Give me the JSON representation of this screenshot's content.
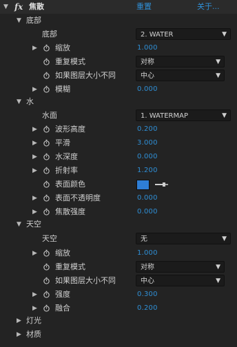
{
  "effect": {
    "fx_glyph": "fx",
    "name": "焦散",
    "reset": "重置",
    "about": "关于..."
  },
  "bottom": {
    "title": "底部",
    "layer_label": "底部",
    "layer_value": "2. WATER",
    "scale_label": "缩放",
    "scale_value": "1.000",
    "repeat_label": "重复模式",
    "repeat_value": "对称",
    "size_label": "如果图层大小不同",
    "size_value": "中心",
    "blur_label": "模糊",
    "blur_value": "0.000"
  },
  "water": {
    "title": "水",
    "surface_label": "水面",
    "surface_value": "1. WATERMAP",
    "wave_label": "波形高度",
    "wave_value": "0.200",
    "smooth_label": "平滑",
    "smooth_value": "3.000",
    "depth_label": "水深度",
    "depth_value": "0.000",
    "refraction_label": "折射率",
    "refraction_value": "1.200",
    "color_label": "表面颜色",
    "color_hex": "#2e7ed6",
    "opacity_label": "表面不透明度",
    "opacity_value": "0.000",
    "caustic_label": "焦散强度",
    "caustic_value": "0.000"
  },
  "sky": {
    "title": "天空",
    "sky_label": "天空",
    "sky_value": "无",
    "scale_label": "缩放",
    "scale_value": "1.000",
    "repeat_label": "重复模式",
    "repeat_value": "对称",
    "size_label": "如果图层大小不同",
    "size_value": "中心",
    "intensity_label": "强度",
    "intensity_value": "0.300",
    "blend_label": "融合",
    "blend_value": "0.200"
  },
  "lighting": {
    "title": "灯光"
  },
  "material": {
    "title": "材质"
  },
  "colors": {
    "value_blue": "#2f8fd6",
    "panel_bg": "#232323"
  }
}
